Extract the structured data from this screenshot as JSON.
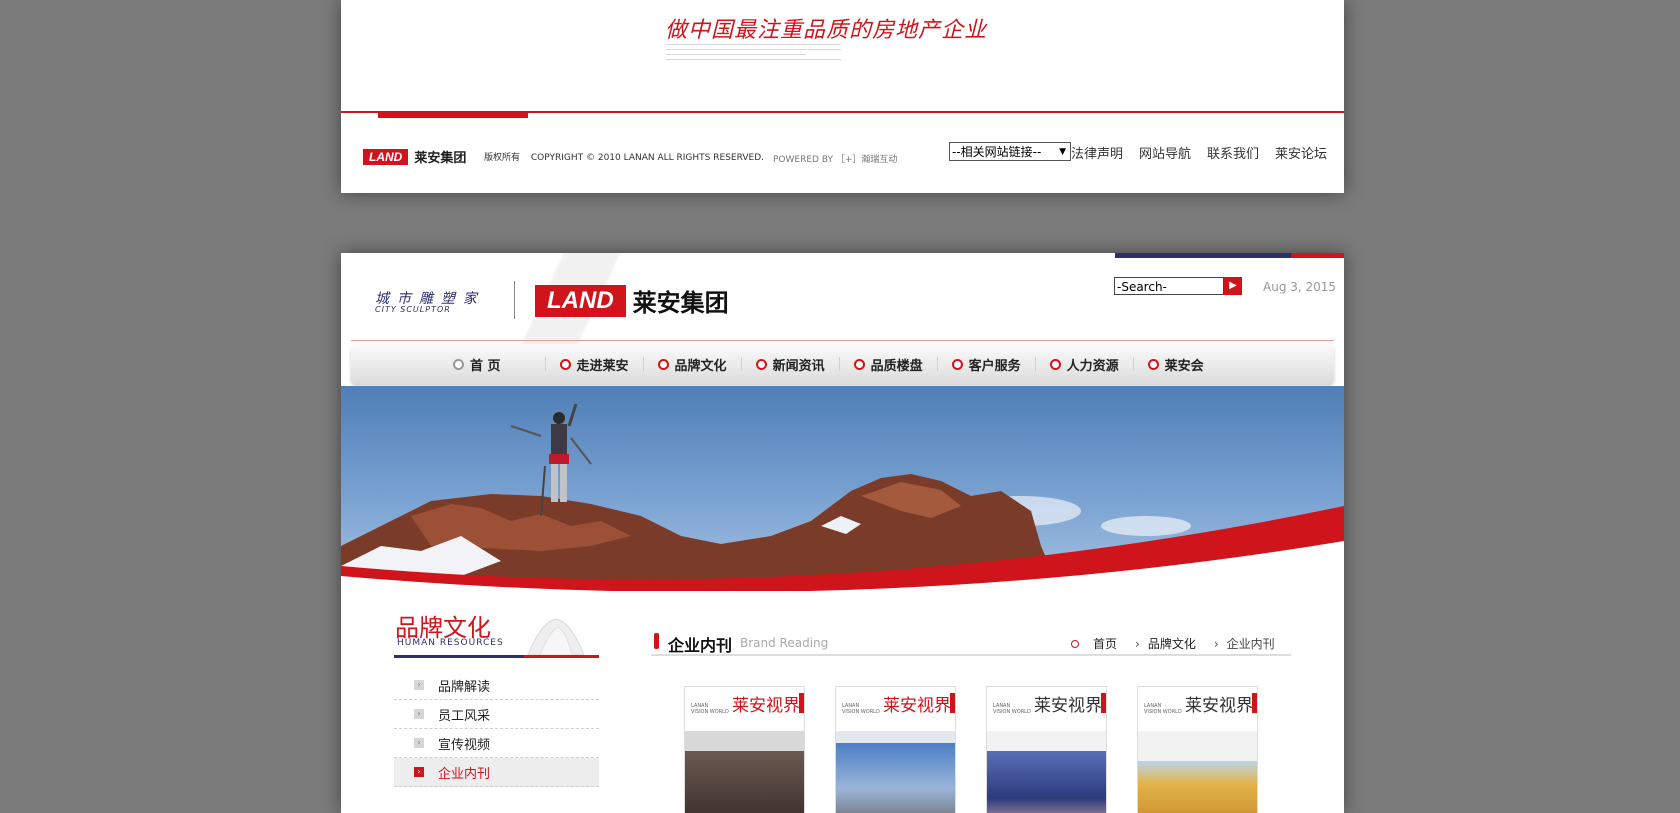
{
  "top_card": {
    "slogan": "做中国最注重品质的房地产企业",
    "footer": {
      "logo_text": "LAND",
      "brand_name": "莱安集团",
      "rights": "版权所有",
      "copyright": "COPYRIGHT © 2010 LANAN ALL RIGHTS RESERVED.",
      "powered_by": "POWERED BY ［+］瀚瑞互动",
      "site_select": "--相关网站链接--",
      "links": [
        "法律声明",
        "网站导航",
        "联系我们",
        "莱安论坛"
      ]
    }
  },
  "header": {
    "city_cn": "城市雕塑家",
    "city_en": "CITY SCULPTOR",
    "logo_text": "LAND",
    "brand_name": "莱安集团",
    "search_placeholder": "-Search-",
    "date": "Aug 3, 2015"
  },
  "nav": {
    "items": [
      "首 页",
      "走进莱安",
      "品牌文化",
      "新闻资讯",
      "品质楼盘",
      "客户服务",
      "人力资源",
      "莱安会"
    ]
  },
  "sidebar": {
    "title_cn": "品牌文化",
    "title_en": "HUMAN RESOURCES",
    "items": [
      "品牌解读",
      "员工风采",
      "宣传视频",
      "企业内刊"
    ],
    "active_index": 3
  },
  "content": {
    "title": "企业内刊",
    "title_en": "Brand Reading",
    "breadcrumb": [
      "首页",
      "品牌文化",
      "企业内刊"
    ],
    "magazines": [
      {
        "title": "莱安视界",
        "sub": "LANAN\nVISION WORLD"
      },
      {
        "title": "莱安视界",
        "sub": "LANAN\nVISION WORLD"
      },
      {
        "title": "莱安视界",
        "sub": "LANAN\nVISION WORLD"
      },
      {
        "title": "莱安视界",
        "sub": "LANAN\nVISION WORLD"
      }
    ]
  },
  "colors": {
    "brand_red": "#d0141b",
    "brand_navy": "#2d2f6b",
    "background": "#7b7b7b"
  }
}
